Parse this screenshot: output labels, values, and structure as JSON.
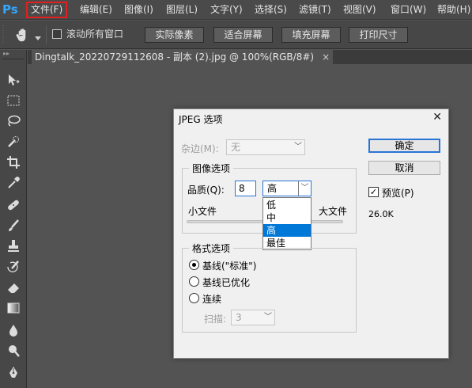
{
  "app": {
    "logo": "Ps",
    "accent": "#31a8ff"
  },
  "menu": {
    "items": [
      "文件(F)",
      "编辑(E)",
      "图像(I)",
      "图层(L)",
      "文字(Y)",
      "选择(S)",
      "滤镜(T)",
      "视图(V)",
      "窗口(W)",
      "帮助(H)"
    ],
    "active_index": 0,
    "highlight_color": "#e02020"
  },
  "options_bar": {
    "tool_icon": "hand-icon",
    "scroll_all_windows_label": "滚动所有窗口",
    "scroll_all_windows_checked": false,
    "buttons": [
      "实际像素",
      "适合屏幕",
      "填充屏幕",
      "打印尺寸"
    ]
  },
  "document_tab": {
    "title": "Dingtalk_20220729112608 - 副本 (2).jpg @ 100%(RGB/8#)",
    "close_glyph": "×"
  },
  "tools": [
    "move-icon",
    "marquee-icon",
    "lasso-icon",
    "quick-select-icon",
    "crop-icon",
    "eyedropper-icon",
    "healing-brush-icon",
    "brush-icon",
    "stamp-icon",
    "history-brush-icon",
    "eraser-icon",
    "gradient-icon",
    "blur-icon",
    "dodge-icon",
    "pen-icon"
  ],
  "dialog": {
    "title": "JPEG 选项",
    "close_glyph": "✕",
    "matte": {
      "label": "杂边(M):",
      "value": "无",
      "enabled": false
    },
    "image_options": {
      "title": "图像选项",
      "quality_label": "品质(Q):",
      "quality_value": "8",
      "quality_level": "高",
      "quality_options": [
        "低",
        "中",
        "高",
        "最佳"
      ],
      "quality_selected_index": 2,
      "small_file_label": "小文件",
      "large_file_label": "大文件"
    },
    "format_options": {
      "title": "格式选项",
      "options": [
        "基线(\"标准\")",
        "基线已优化",
        "连续"
      ],
      "selected_index": 0,
      "scans_label": "扫描:",
      "scans_value": "3"
    },
    "ok_label": "确定",
    "cancel_label": "取消",
    "preview_label": "预览(P)",
    "preview_checked": true,
    "file_size": "26.0K"
  }
}
